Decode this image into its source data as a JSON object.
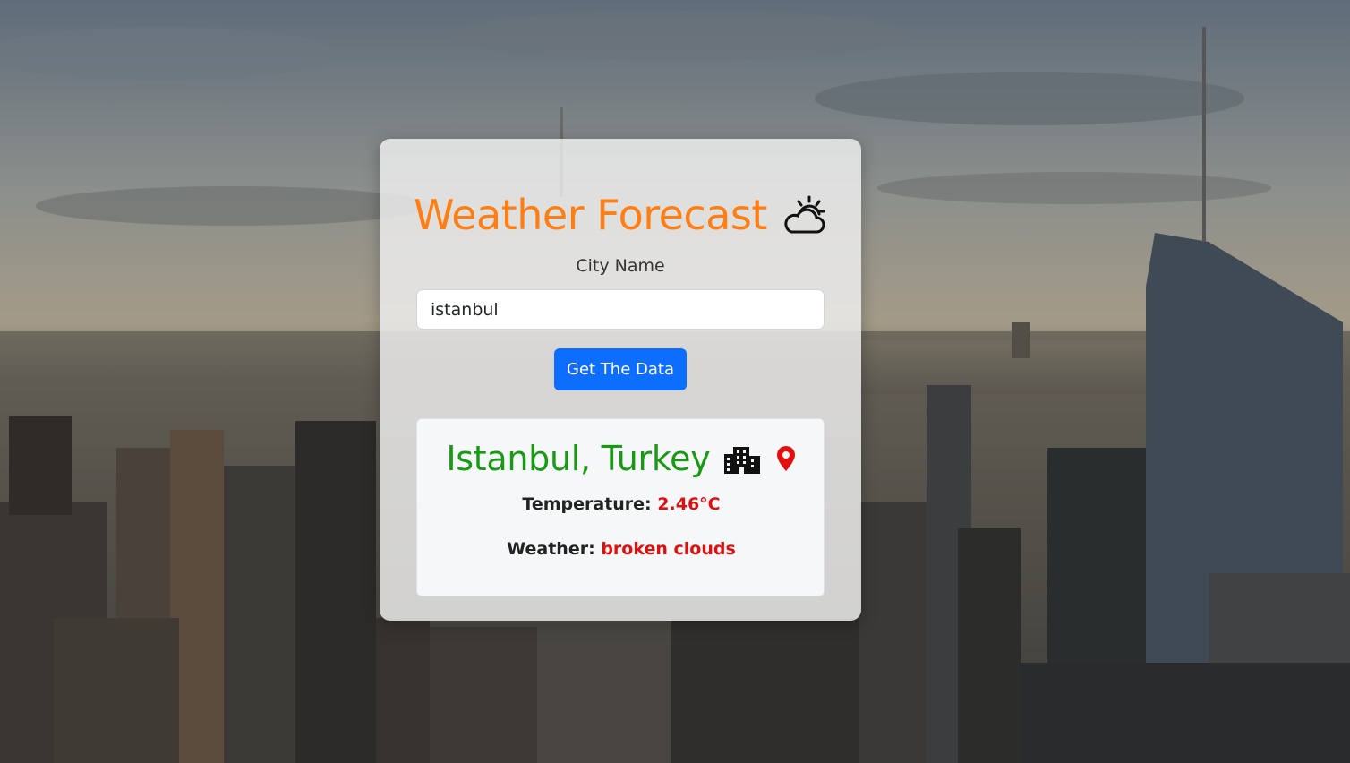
{
  "app": {
    "title": "Weather Forecast",
    "title_icon": "sun-behind-cloud-icon"
  },
  "form": {
    "city_label": "City Name",
    "city_value": "istanbul",
    "submit_label": "Get The Data"
  },
  "result": {
    "location": "Istanbul, Turkey",
    "location_icons": [
      "city-buildings-icon",
      "map-pin-icon"
    ],
    "temperature_label": "Temperature:",
    "temperature_value": "2.46°C",
    "weather_label": "Weather:",
    "weather_value": "broken clouds"
  },
  "colors": {
    "title": "#fd7e14",
    "location": "#1a9a14",
    "value": "#e01010",
    "button": "#0d6efd"
  }
}
